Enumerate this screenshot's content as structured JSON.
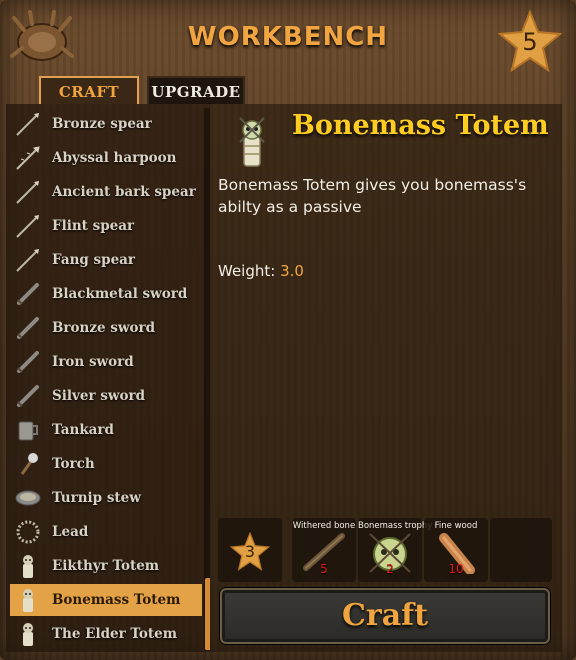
{
  "header": {
    "title": "WORKBENCH",
    "station_level": "5"
  },
  "tabs": {
    "craft": "CRAFT",
    "upgrade": "UPGRADE"
  },
  "recipes": [
    {
      "label": "Bronze spear",
      "icon": "spear-icon"
    },
    {
      "label": "Abyssal harpoon",
      "icon": "harpoon-icon"
    },
    {
      "label": "Ancient bark spear",
      "icon": "spear-icon"
    },
    {
      "label": "Flint spear",
      "icon": "spear-icon"
    },
    {
      "label": "Fang spear",
      "icon": "spear-icon"
    },
    {
      "label": "Blackmetal sword",
      "icon": "sword-icon"
    },
    {
      "label": "Bronze sword",
      "icon": "sword-icon"
    },
    {
      "label": "Iron sword",
      "icon": "sword-icon"
    },
    {
      "label": "Silver sword",
      "icon": "sword-icon"
    },
    {
      "label": "Tankard",
      "icon": "tankard-icon"
    },
    {
      "label": "Torch",
      "icon": "torch-icon"
    },
    {
      "label": "Turnip stew",
      "icon": "bowl-icon"
    },
    {
      "label": "Lead",
      "icon": "rope-icon"
    },
    {
      "label": "Eikthyr Totem",
      "icon": "totem-icon"
    },
    {
      "label": "Bonemass Totem",
      "icon": "totem-icon",
      "selected": true
    },
    {
      "label": "The Elder Totem",
      "icon": "totem-icon"
    }
  ],
  "selected_item": {
    "name": "Bonemass Totem",
    "description": "Bonemass Totem gives you bonemass's abilty as a passive",
    "weight_label": "Weight:",
    "weight_value": "3.0"
  },
  "requirements": {
    "quality_level": "3",
    "items": [
      {
        "name": "Withered bone",
        "qty": "5",
        "icon": "bone-icon"
      },
      {
        "name": "Bonemass trophy",
        "qty": "2",
        "icon": "trophy-icon"
      },
      {
        "name": "Fine wood",
        "qty": "10",
        "icon": "wood-icon"
      }
    ]
  },
  "craft_button": "Craft",
  "colors": {
    "accent": "#f0a540",
    "title": "#ffcc22",
    "selected_row": "#e3a246",
    "qty": "#e0191a"
  }
}
